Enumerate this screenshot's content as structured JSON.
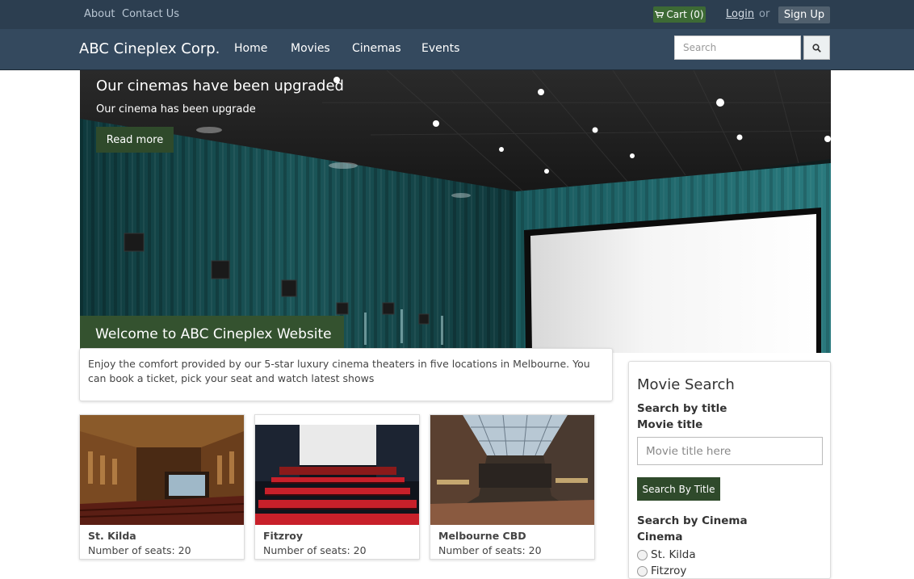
{
  "topbar": {
    "about": "About",
    "contact": "Contact Us",
    "cart": "Cart (0)",
    "login": "Login",
    "or": "or",
    "signup": "Sign Up"
  },
  "navbar": {
    "brand": "ABC Cineplex Corp.",
    "items": [
      "Home",
      "Movies",
      "Cinemas",
      "Events"
    ],
    "search_placeholder": "Search"
  },
  "hero": {
    "title": "Our cinemas have been upgraded",
    "subtitle": "Our cinema has been upgrade",
    "button": "Read more",
    "welcome": "Welcome to ABC Cineplex Website"
  },
  "intro": {
    "text": "Enjoy the comfort provided by our 5-star luxury cinema theaters in five locations in Melbourne. You can book a ticket, pick your seat and watch latest shows"
  },
  "cinemas": [
    {
      "name": "St. Kilda",
      "seats": "Number of seats: 20"
    },
    {
      "name": "Fitzroy",
      "seats": "Number of seats: 20"
    },
    {
      "name": "Melbourne CBD",
      "seats": "Number of seats: 20"
    }
  ],
  "sidebar": {
    "title": "Movie Search",
    "by_title_heading": "Search by title",
    "movie_title_label": "Movie title",
    "movie_title_placeholder": "Movie title here",
    "search_button": "Search By Title",
    "by_cinema_heading": "Search by Cinema",
    "cinema_label": "Cinema",
    "options": [
      "St. Kilda",
      "Fitzroy"
    ]
  },
  "colors": {
    "topbar": "#2c3e50",
    "navbar": "#34495e",
    "accent_green": "#2f4a2b",
    "cart_green": "#3d6a35"
  }
}
